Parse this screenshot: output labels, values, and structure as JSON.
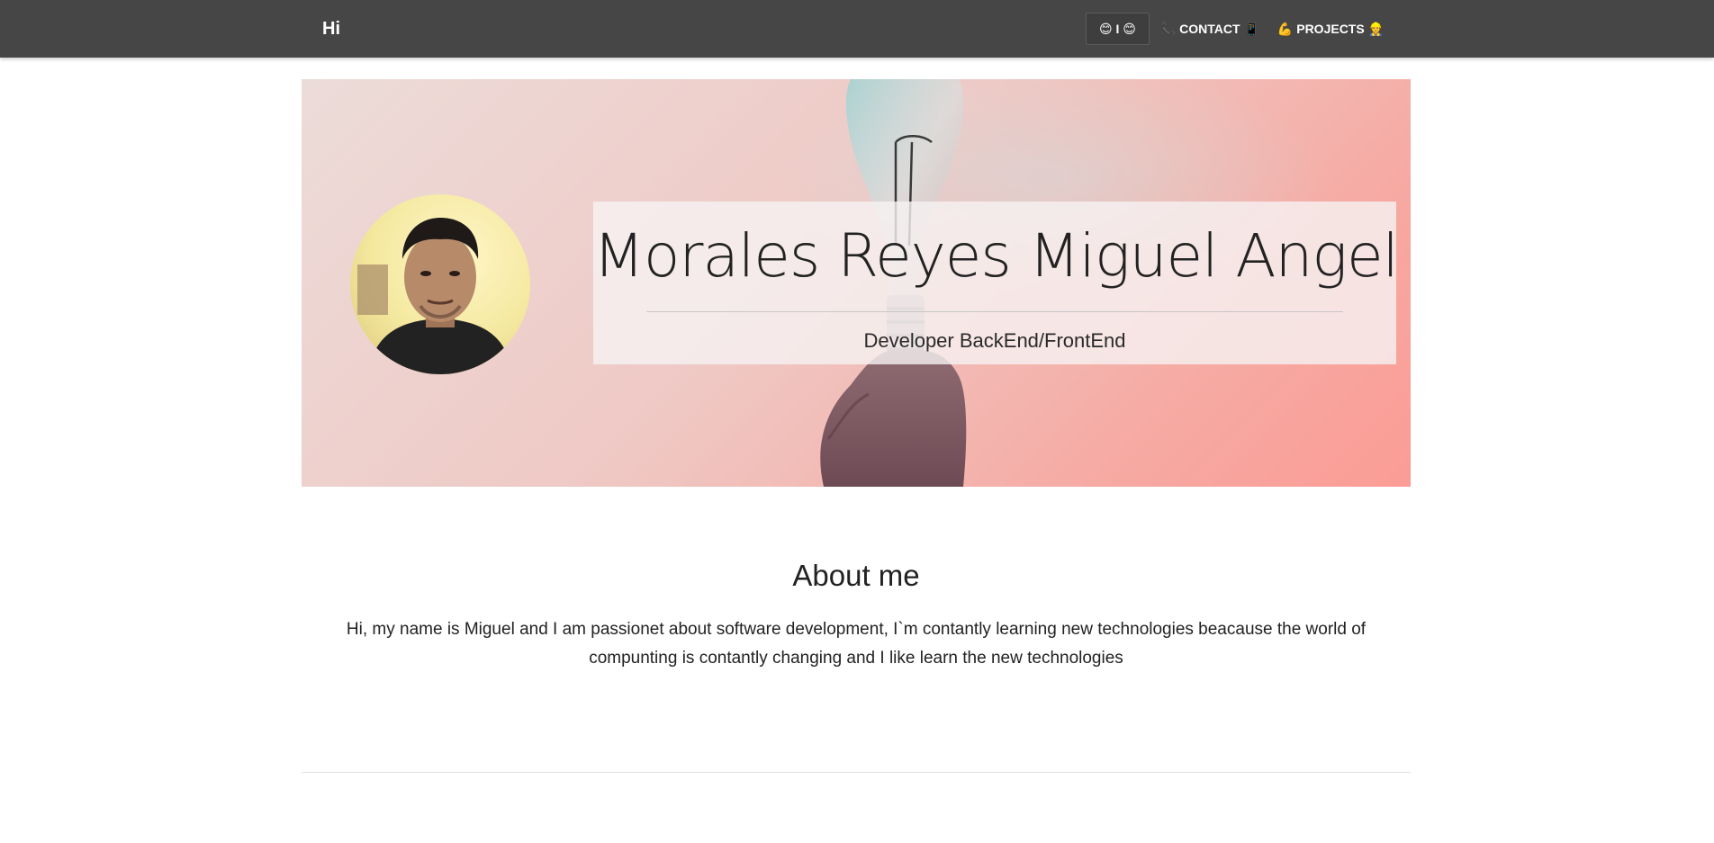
{
  "navbar": {
    "brand": "Hi",
    "links": [
      {
        "label": "😊 I 😊",
        "active": true
      },
      {
        "label": "📞 CONTACT 📱",
        "active": false
      },
      {
        "label": "💪 PROJECTS 👷",
        "active": false
      }
    ]
  },
  "hero": {
    "name": "Morales Reyes Miguel Angel",
    "role": "Developer BackEnd/FrontEnd"
  },
  "about": {
    "title": "About me",
    "text": "Hi, my name is Miguel and I am passionet about software development, I`m contantly learning new technologies beacause the world of compunting is contantly changing and I like learn the new technologies"
  },
  "colors": {
    "navbar_bg": "#464646",
    "hero_gradient_start": "#ecdcd9",
    "hero_gradient_end": "#fb9c95"
  }
}
